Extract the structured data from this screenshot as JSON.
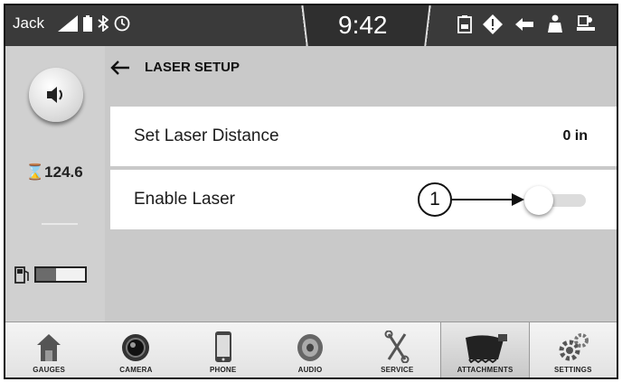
{
  "status": {
    "user": "Jack",
    "time": "9:42",
    "left_icons": [
      "signal-icon",
      "battery-icon",
      "bluetooth-icon",
      "clock-icon"
    ],
    "right_icons": [
      "document-icon",
      "warning-diamond-icon",
      "hydraulic-icon",
      "operator-icon",
      "machine-icon"
    ]
  },
  "rail": {
    "volume_icon": "speaker-icon",
    "hours_value": "124.6",
    "hours_icon": "hourglass-icon",
    "fuel_icon": "fuel-pump-icon",
    "fuel_level": 0.4
  },
  "screen": {
    "back_icon": "back-arrow-icon",
    "title": "LASER SETUP"
  },
  "settings": [
    {
      "label": "Set Laser Distance",
      "value": "0 in"
    },
    {
      "label": "Enable Laser",
      "enabled": false,
      "callout": "1"
    }
  ],
  "nav": [
    {
      "label": "GAUGES",
      "icon": "home-icon",
      "active": false
    },
    {
      "label": "CAMERA",
      "icon": "camera-icon",
      "active": false
    },
    {
      "label": "PHONE",
      "icon": "phone-icon",
      "active": false
    },
    {
      "label": "AUDIO",
      "icon": "speaker-icon",
      "active": false
    },
    {
      "label": "SERVICE",
      "icon": "tools-icon",
      "active": false
    },
    {
      "label": "ATTACHMENTS",
      "icon": "bucket-icon",
      "active": true
    },
    {
      "label": "SETTINGS",
      "icon": "gears-icon",
      "active": false
    }
  ]
}
